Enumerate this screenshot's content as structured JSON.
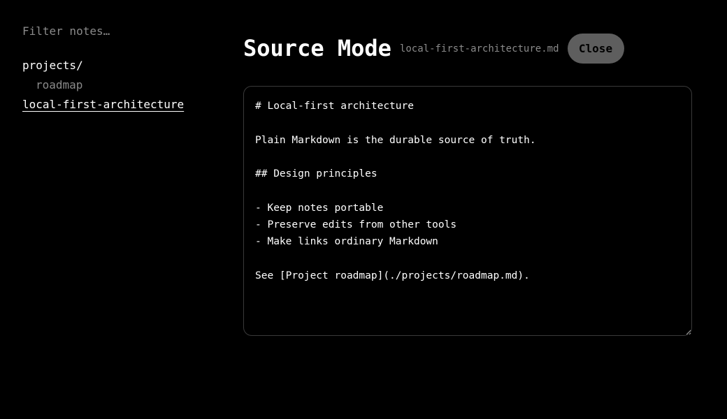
{
  "sidebar": {
    "filter_placeholder": "Filter notes…",
    "tree": [
      {
        "label": "projects/",
        "type": "folder"
      },
      {
        "label": "roadmap",
        "type": "note"
      },
      {
        "label": "local-first-architecture",
        "type": "note",
        "active": true
      }
    ]
  },
  "header": {
    "title": "Source Mode",
    "filename": "local-first-architecture.md",
    "close_label": "Close"
  },
  "editor": {
    "content": "# Local-first architecture\n\nPlain Markdown is the durable source of truth.\n\n## Design principles\n\n- Keep notes portable\n- Preserve edits from other tools\n- Make links ordinary Markdown\n\nSee [Project roadmap](./projects/roadmap.md)."
  },
  "colors": {
    "background": "#000000",
    "text": "#ffffff",
    "muted": "#8a8a8a",
    "button_bg": "#5e5e5e",
    "border": "#3a3a3a"
  }
}
